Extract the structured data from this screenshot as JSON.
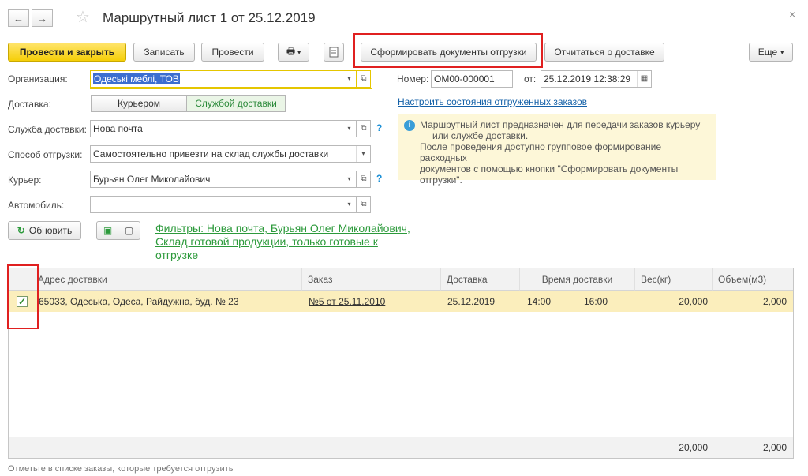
{
  "window": {
    "title": "Маршрутный лист 1 от 25.12.2019",
    "back_glyph": "←",
    "forward_glyph": "→",
    "star_glyph": "☆",
    "close_glyph": "×"
  },
  "toolbar": {
    "post_and_close": "Провести и закрыть",
    "save": "Записать",
    "post": "Провести",
    "print_glyph": "🖶",
    "create_shipping_docs": "Сформировать документы отгрузки",
    "report_delivery": "Отчитаться о доставке",
    "more": "Еще"
  },
  "form": {
    "organization_label": "Организация:",
    "organization_value": "Одеські меблі, ТОВ",
    "number_label": "Номер:",
    "number_value": "ОМ00-000001",
    "date_label": "от:",
    "date_value": "25.12.2019 12:38:29",
    "delivery_label": "Доставка:",
    "delivery_options": [
      "Курьером",
      "Службой доставки"
    ],
    "delivery_service_label": "Служба доставки:",
    "delivery_service_value": "Нова почта",
    "shipping_method_label": "Способ отгрузки:",
    "shipping_method_value": "Самостоятельно привезти на склад службы доставки",
    "courier_label": "Курьер:",
    "courier_value": "Бурьян Олег Миколайович",
    "vehicle_label": "Автомобиль:",
    "vehicle_value": "",
    "configure_link": "Настроить состояния отгруженных заказов",
    "info_text_1": "Маршрутный лист предназначен для передачи заказов курьеру",
    "info_text_2": "или службе доставки.",
    "info_text_3": "После проведения доступно групповое формирование расходных",
    "info_text_4": "документов с помощью кнопки \"Сформировать документы",
    "info_text_5": "отгрузки\".",
    "refresh_label": "Обновить",
    "filters_line_1": "Фильтры: Нова почта, Бурьян Олег Миколайович,",
    "filters_line_2": "Склад готовой продукции, только готовые к",
    "filters_line_3": "отгрузке"
  },
  "table": {
    "headers": [
      "Адрес доставки",
      "Заказ",
      "Доставка",
      "Время доставки",
      "Вес(кг)",
      "Объем(м3)"
    ],
    "rows": [
      {
        "checked": true,
        "address": "65033, Одеська, Одеса, Райдужна, буд. № 23",
        "order": "№5 от 25.11.2010",
        "delivery": "25.12.2019",
        "time_from": "14:00",
        "time_to": "16:00",
        "weight": "20,000",
        "volume": "2,000"
      }
    ],
    "total_weight": "20,000",
    "total_volume": "2,000"
  },
  "status_bar": "Отметьте в списке заказы, которые требуется отгрузить",
  "colors": {
    "primary_button": "#f5cf08",
    "highlight_box": "#e02020",
    "selected_row": "#fbeebc",
    "link": "#1461a8",
    "filter_link": "#2c9a3b"
  }
}
